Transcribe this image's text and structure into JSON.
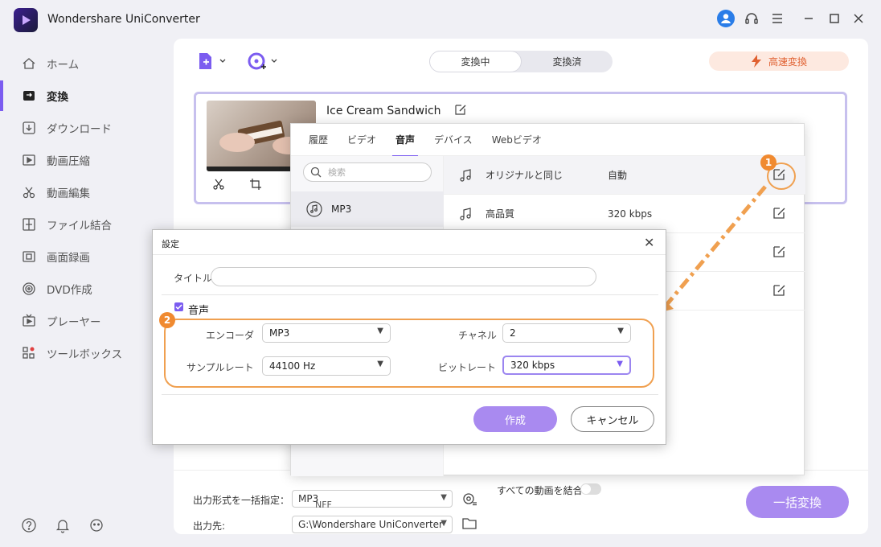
{
  "app": {
    "title": "Wondershare UniConverter"
  },
  "sidebar": {
    "items": [
      {
        "label": "ホーム",
        "icon": "home-icon"
      },
      {
        "label": "変換",
        "icon": "convert-icon",
        "active": true
      },
      {
        "label": "ダウンロード",
        "icon": "download-icon"
      },
      {
        "label": "動画圧縮",
        "icon": "compress-icon"
      },
      {
        "label": "動画編集",
        "icon": "scissors-icon"
      },
      {
        "label": "ファイル結合",
        "icon": "merge-icon"
      },
      {
        "label": "画面録画",
        "icon": "screen-record-icon"
      },
      {
        "label": "DVD作成",
        "icon": "dvd-icon"
      },
      {
        "label": "プレーヤー",
        "icon": "player-icon"
      },
      {
        "label": "ツールボックス",
        "icon": "toolbox-icon"
      }
    ]
  },
  "tabs": {
    "converting": "変換中",
    "converted": "変換済"
  },
  "speed_label": "高速変換",
  "file": {
    "name": "Ice Cream Sandwich"
  },
  "format_panel": {
    "tabs": [
      "履歴",
      "ビデオ",
      "音声",
      "デバイス",
      "Webビデオ"
    ],
    "active_tab": "音声",
    "search_placeholder": "検索",
    "formats": [
      "MP3"
    ],
    "partial_format": "NFF",
    "presets": [
      {
        "name": "オリジナルと同じ",
        "value": "自動"
      },
      {
        "name": "高品質",
        "value": "320 kbps"
      }
    ]
  },
  "dialog": {
    "title": "設定",
    "title_label": "タイトル",
    "title_value": "",
    "audio_label": "音声",
    "encoder_label": "エンコーダ",
    "encoder_value": "MP3",
    "channel_label": "チャネル",
    "channel_value": "2",
    "sample_rate_label": "サンプルレート",
    "sample_rate_value": "44100 Hz",
    "bitrate_label": "ビットレート",
    "bitrate_value": "320 kbps",
    "create_label": "作成",
    "cancel_label": "キャンセル"
  },
  "badges": {
    "one": "1",
    "two": "2"
  },
  "bottom": {
    "output_format_label": "出力形式を一括指定：",
    "output_format_value": "MP3",
    "merge_label": "すべての動画を結合",
    "output_dir_label": "出力先:",
    "output_dir_value": "G:\\Wondershare UniConverter",
    "convert_all": "一括変換"
  },
  "colors": {
    "accent": "#7b5cf0",
    "button": "#a98af0",
    "highlight": "#f0a050"
  }
}
